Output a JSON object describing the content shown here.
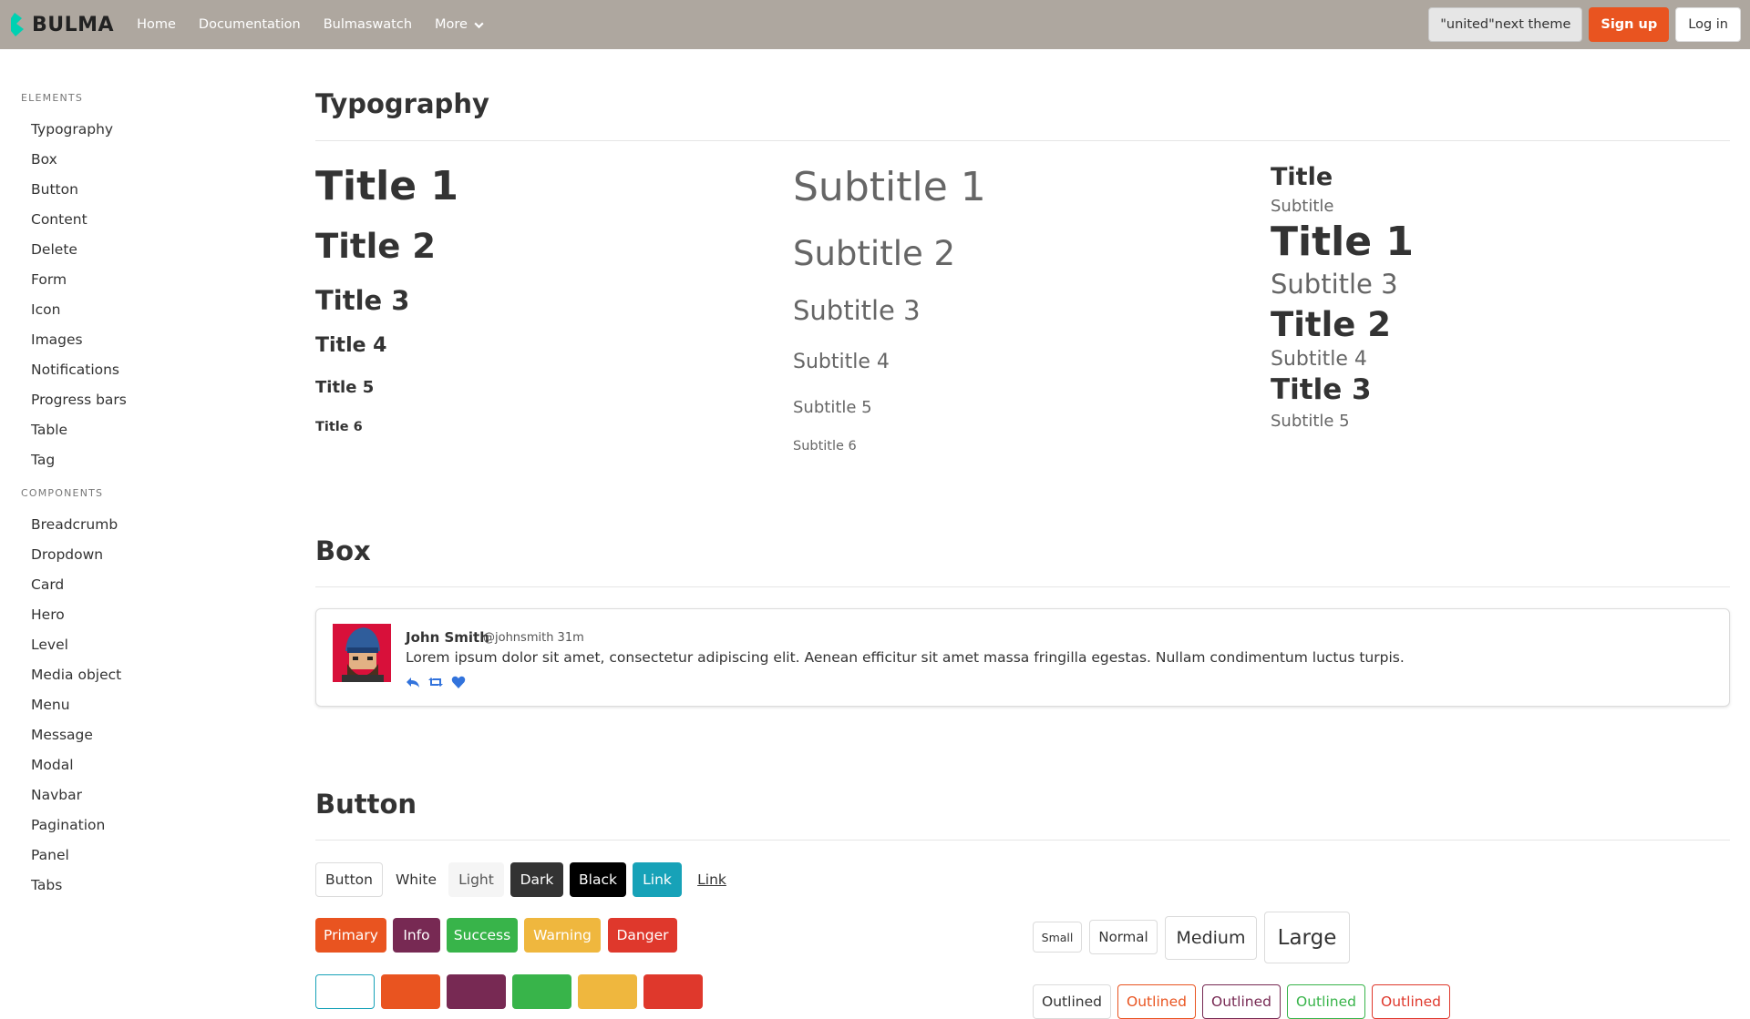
{
  "navbar": {
    "brand": "BULMA",
    "links": [
      "Home",
      "Documentation",
      "Bulmaswatch",
      "More"
    ],
    "theme_button": "\"united\"next theme",
    "signup": "Sign up",
    "login": "Log in",
    "bg_color": "#aea79f"
  },
  "sidebar": {
    "elements_label": "ELEMENTS",
    "elements": [
      "Typography",
      "Box",
      "Button",
      "Content",
      "Delete",
      "Form",
      "Icon",
      "Images",
      "Notifications",
      "Progress bars",
      "Table",
      "Tag"
    ],
    "components_label": "COMPONENTS",
    "components": [
      "Breadcrumb",
      "Dropdown",
      "Card",
      "Hero",
      "Level",
      "Media object",
      "Menu",
      "Message",
      "Modal",
      "Navbar",
      "Pagination",
      "Panel",
      "Tabs"
    ]
  },
  "typography": {
    "heading": "Typography",
    "titles": [
      "Title 1",
      "Title 2",
      "Title 3",
      "Title 4",
      "Title 5",
      "Title 6"
    ],
    "subtitles": [
      "Subtitle 1",
      "Subtitle 2",
      "Subtitle 3",
      "Subtitle 4",
      "Subtitle 5",
      "Subtitle 6"
    ],
    "pairs": {
      "title": "Title",
      "subtitle": "Subtitle",
      "t1": "Title 1",
      "s3": "Subtitle 3",
      "t2": "Title 2",
      "s4": "Subtitle 4",
      "t3": "Title 3",
      "s5": "Subtitle 5"
    }
  },
  "box": {
    "heading": "Box",
    "name": "John Smith",
    "handle": "@johnsmith 31m",
    "text": "Lorem ipsum dolor sit amet, consectetur adipiscing elit. Aenean efficitur sit amet massa fringilla egestas. Nullam condimentum luctus turpis."
  },
  "button": {
    "heading": "Button",
    "row1": [
      "Button",
      "White",
      "Light",
      "Dark",
      "Black",
      "Link",
      "Link"
    ],
    "row2": [
      "Primary",
      "Info",
      "Success",
      "Warning",
      "Danger"
    ],
    "sizes": [
      "Small",
      "Normal",
      "Medium",
      "Large"
    ],
    "outlined": [
      "Outlined",
      "Outlined",
      "Outlined",
      "Outlined",
      "Outlined"
    ],
    "colors": {
      "primary": "#e95420",
      "info": "#772953",
      "success": "#38b44a",
      "warning": "#efb73e",
      "danger": "#df382c",
      "link": "#17a2b8",
      "dark": "#333333",
      "black": "#000000",
      "light": "#f5f5f5"
    }
  }
}
